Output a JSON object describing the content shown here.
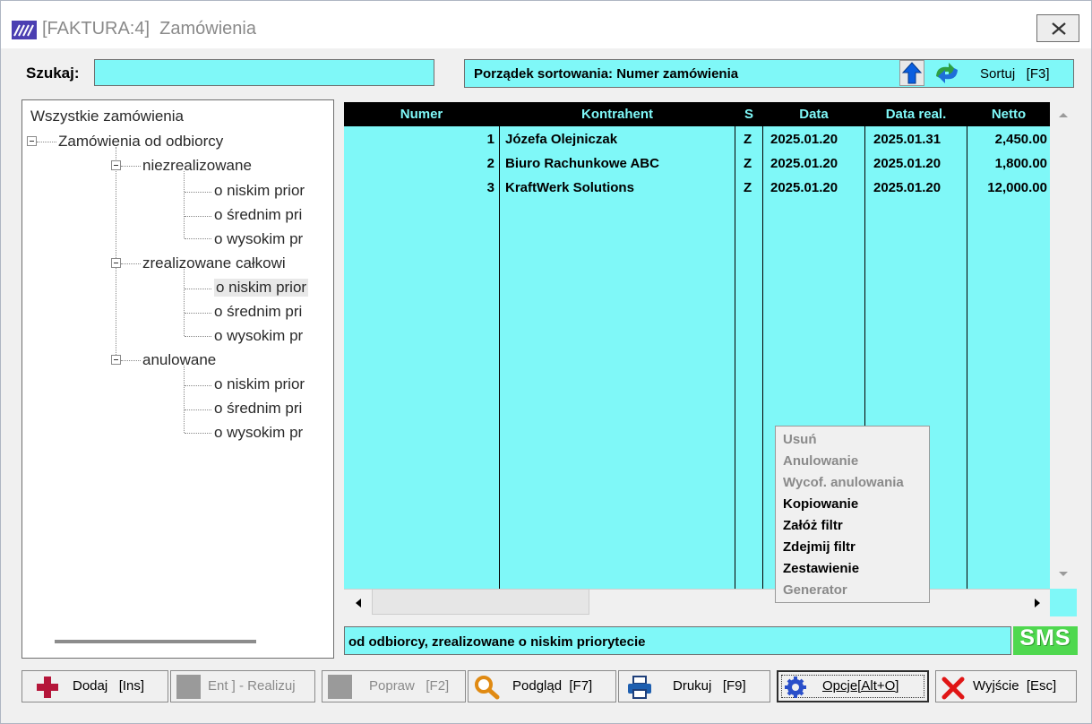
{
  "window": {
    "title": "[FAKTURA:4]  Zamówienia",
    "close_icon": "close-x-icon"
  },
  "search": {
    "label": "Szukaj:",
    "value": ""
  },
  "sort": {
    "text": "Porządek sortowania: Numer zamówienia",
    "button_label": "Sortuj   [F3]"
  },
  "tree": {
    "root": "Wszystkie zamówienia",
    "group": "Zamówienia od odbiorcy",
    "sections": [
      {
        "label": "niezrealizowane",
        "items": [
          "o niskim prior",
          "o średnim pri",
          "o wysokim pr"
        ]
      },
      {
        "label": "zrealizowane całkowi",
        "items": [
          "o niskim prior",
          "o średnim pri",
          "o wysokim pr"
        ]
      },
      {
        "label": "anulowane",
        "items": [
          "o niskim prior",
          "o średnim pri",
          "o wysokim pr"
        ]
      }
    ]
  },
  "grid": {
    "headers": [
      "Numer",
      "Kontrahent",
      "S",
      "Data",
      "Data real.",
      "Netto"
    ],
    "rows": [
      {
        "numer": "1",
        "kontrahent": "Józefa Olejniczak",
        "s": "Z",
        "data": "2025.01.20",
        "data_real": "2025.01.31",
        "netto": "2,450.00"
      },
      {
        "numer": "2",
        "kontrahent": "Biuro Rachunkowe ABC",
        "s": "Z",
        "data": "2025.01.20",
        "data_real": "2025.01.20",
        "netto": "1,800.00"
      },
      {
        "numer": "3",
        "kontrahent": "KraftWerk Solutions",
        "s": "Z",
        "data": "2025.01.20",
        "data_real": "2025.01.20",
        "netto": "12,000.00"
      }
    ]
  },
  "context_menu": {
    "items": [
      {
        "label": "Usuń",
        "enabled": false
      },
      {
        "label": "Anulowanie",
        "enabled": false
      },
      {
        "label": "Wycof. anulowania",
        "enabled": false
      },
      {
        "label": "Kopiowanie",
        "enabled": true
      },
      {
        "label": "Załóż filtr",
        "enabled": true
      },
      {
        "label": "Zdejmij filtr",
        "enabled": true
      },
      {
        "label": "Zestawienie",
        "enabled": true
      },
      {
        "label": "Generator",
        "enabled": false
      }
    ]
  },
  "status": {
    "text": "od odbiorcy, zrealizowane o niskim priorytecie",
    "sms_label": "SMS"
  },
  "toolbar": {
    "add": "Dodaj   [Ins]",
    "realize": "Ent ] - Realizuj",
    "edit": "Popraw   [F2]",
    "preview": "Podgląd  [F7]",
    "print": "Drukuj   [F9]",
    "options": "Opcje[Alt+O]",
    "exit": "Wyjście  [Esc]"
  },
  "colors": {
    "grid_bg": "#7ff8f8",
    "header_bg": "#000000",
    "sms_green": "#4fd84f"
  }
}
